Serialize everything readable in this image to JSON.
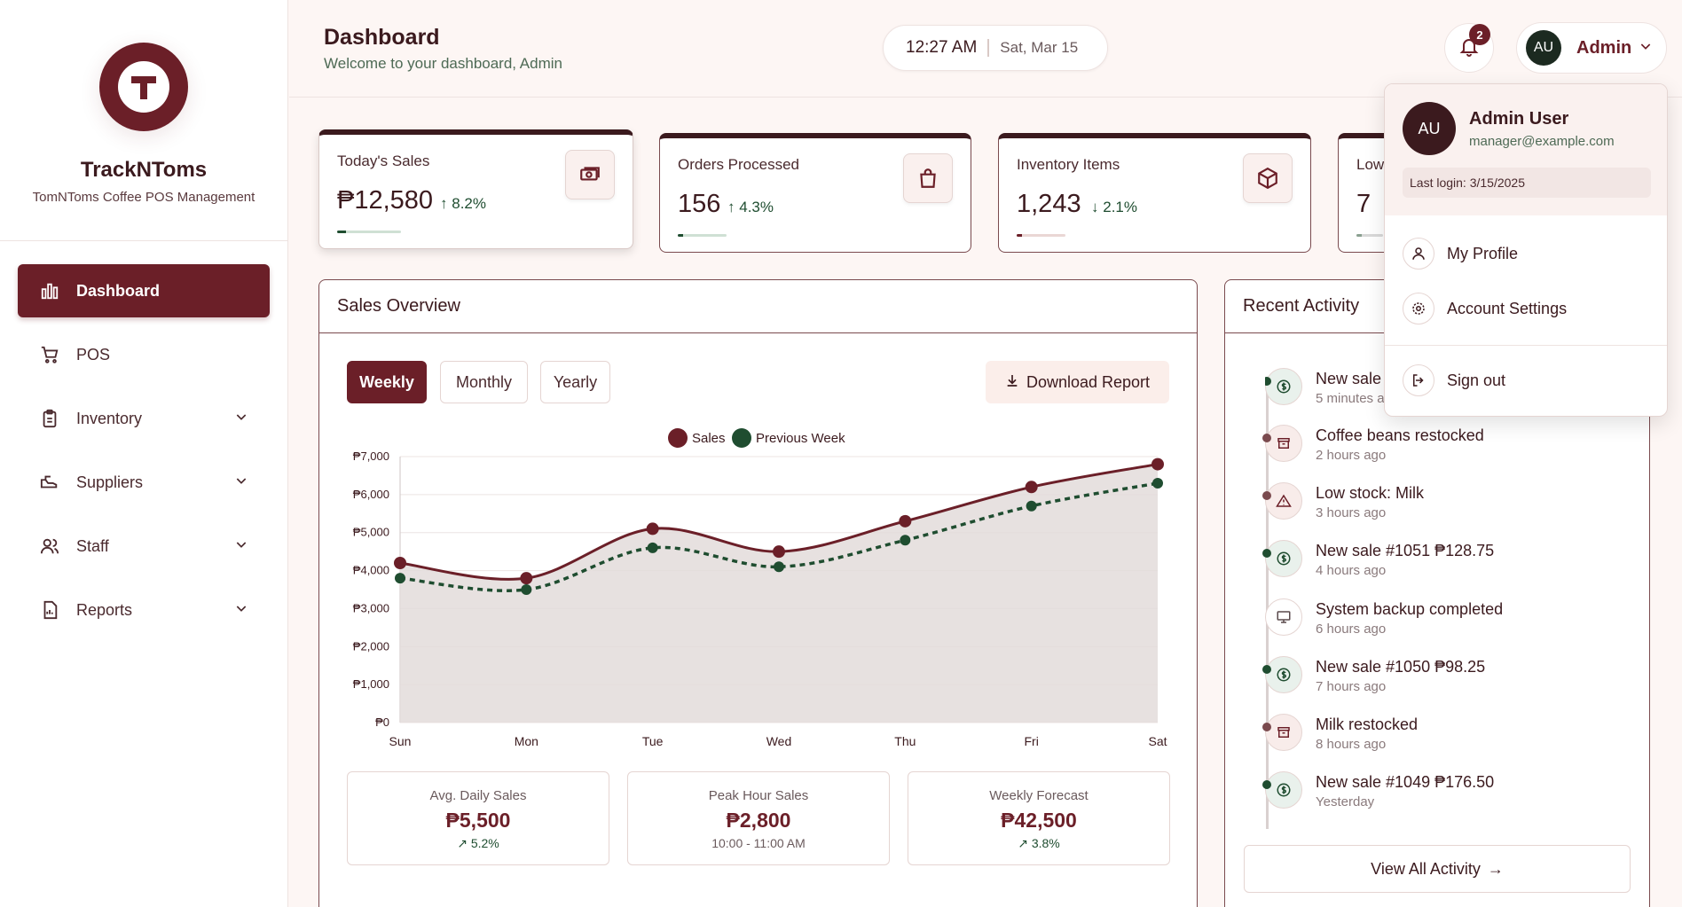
{
  "brand": {
    "name": "TrackNToms",
    "subtitle": "TomNToms Coffee POS Management"
  },
  "nav": {
    "items": [
      {
        "label": "Dashboard",
        "icon": "bar-chart-icon",
        "active": true
      },
      {
        "label": "POS",
        "icon": "cart-icon"
      },
      {
        "label": "Inventory",
        "icon": "clipboard-icon",
        "expandable": true
      },
      {
        "label": "Suppliers",
        "icon": "truck-icon",
        "expandable": true
      },
      {
        "label": "Staff",
        "icon": "users-icon",
        "expandable": true
      },
      {
        "label": "Reports",
        "icon": "document-icon",
        "expandable": true
      }
    ]
  },
  "header": {
    "title": "Dashboard",
    "subtitle": "Welcome to your dashboard, Admin",
    "time": "12:27 AM",
    "date": "Sat, Mar 15",
    "notification_count": "2",
    "user_initials": "AU",
    "user_name": "Admin"
  },
  "stats": [
    {
      "label": "Today's Sales",
      "value": "₱12,580",
      "trend": "8.2%",
      "direction": "up",
      "icon": "cash-icon",
      "progress": 0.25
    },
    {
      "label": "Orders Processed",
      "value": "156",
      "trend": "4.3%",
      "direction": "up",
      "icon": "shopping-bag-icon",
      "progress": 0.18
    },
    {
      "label": "Inventory Items",
      "value": "1,243",
      "trend": "2.1%",
      "direction": "down",
      "icon": "box-icon",
      "progress": 0.2
    },
    {
      "label": "Low",
      "value": "7"
    }
  ],
  "sales": {
    "title": "Sales Overview",
    "tabs": [
      "Weekly",
      "Monthly",
      "Yearly"
    ],
    "active_tab": "Weekly",
    "download_label": "Download Report",
    "summary": [
      {
        "label": "Avg. Daily Sales",
        "value": "₱5,500",
        "sub": "5.2%",
        "trend": true
      },
      {
        "label": "Peak Hour Sales",
        "value": "₱2,800",
        "sub": "10:00 - 11:00 AM",
        "trend": false
      },
      {
        "label": "Weekly Forecast",
        "value": "₱42,500",
        "sub": "3.8%",
        "trend": true
      }
    ]
  },
  "chart_data": {
    "type": "line",
    "x": [
      "Sun",
      "Mon",
      "Tue",
      "Wed",
      "Thu",
      "Fri",
      "Sat"
    ],
    "series": [
      {
        "name": "Sales",
        "values": [
          4200,
          3800,
          5100,
          4500,
          5300,
          6200,
          6800
        ],
        "color": "#6b1f28"
      },
      {
        "name": "Previous Week",
        "values": [
          3800,
          3500,
          4600,
          4100,
          4800,
          5700,
          6300
        ],
        "color": "#1f4d30"
      }
    ],
    "y_ticks": [
      "₱0",
      "₱1,000",
      "₱2,000",
      "₱3,000",
      "₱4,000",
      "₱5,000",
      "₱6,000",
      "₱7,000"
    ],
    "ylim": [
      0,
      7000
    ],
    "legend": "top-center",
    "grid": true
  },
  "activity": {
    "title": "Recent Activity",
    "items": [
      {
        "title": "New sale",
        "time": "5 minutes a",
        "icon": "dollar-icon",
        "kind": "sale"
      },
      {
        "title": "Coffee beans restocked",
        "time": "2 hours ago",
        "icon": "archive-icon",
        "kind": "stock"
      },
      {
        "title": "Low stock: Milk",
        "time": "3 hours ago",
        "icon": "warning-icon",
        "kind": "stock"
      },
      {
        "title": "New sale #1051 ₱128.75",
        "time": "4 hours ago",
        "icon": "dollar-icon",
        "kind": "sale"
      },
      {
        "title": "System backup completed",
        "time": "6 hours ago",
        "icon": "monitor-icon",
        "kind": "system"
      },
      {
        "title": "New sale #1050 ₱98.25",
        "time": "7 hours ago",
        "icon": "dollar-icon",
        "kind": "sale"
      },
      {
        "title": "Milk restocked",
        "time": "8 hours ago",
        "icon": "archive-icon",
        "kind": "stock"
      },
      {
        "title": "New sale #1049 ₱176.50",
        "time": "Yesterday",
        "icon": "dollar-icon",
        "kind": "sale"
      }
    ],
    "view_all": "View All Activity"
  },
  "user_menu": {
    "initials": "AU",
    "name": "Admin User",
    "email": "manager@example.com",
    "last_login": "Last login: 3/15/2025",
    "items": [
      {
        "label": "My Profile",
        "icon": "user-icon"
      },
      {
        "label": "Account Settings",
        "icon": "gear-icon"
      },
      {
        "label": "Sign out",
        "icon": "sign-out-icon"
      }
    ]
  },
  "colors": {
    "primary": "#6b1f28",
    "secondary": "#1f4d30",
    "background": "#fdf6f4"
  }
}
